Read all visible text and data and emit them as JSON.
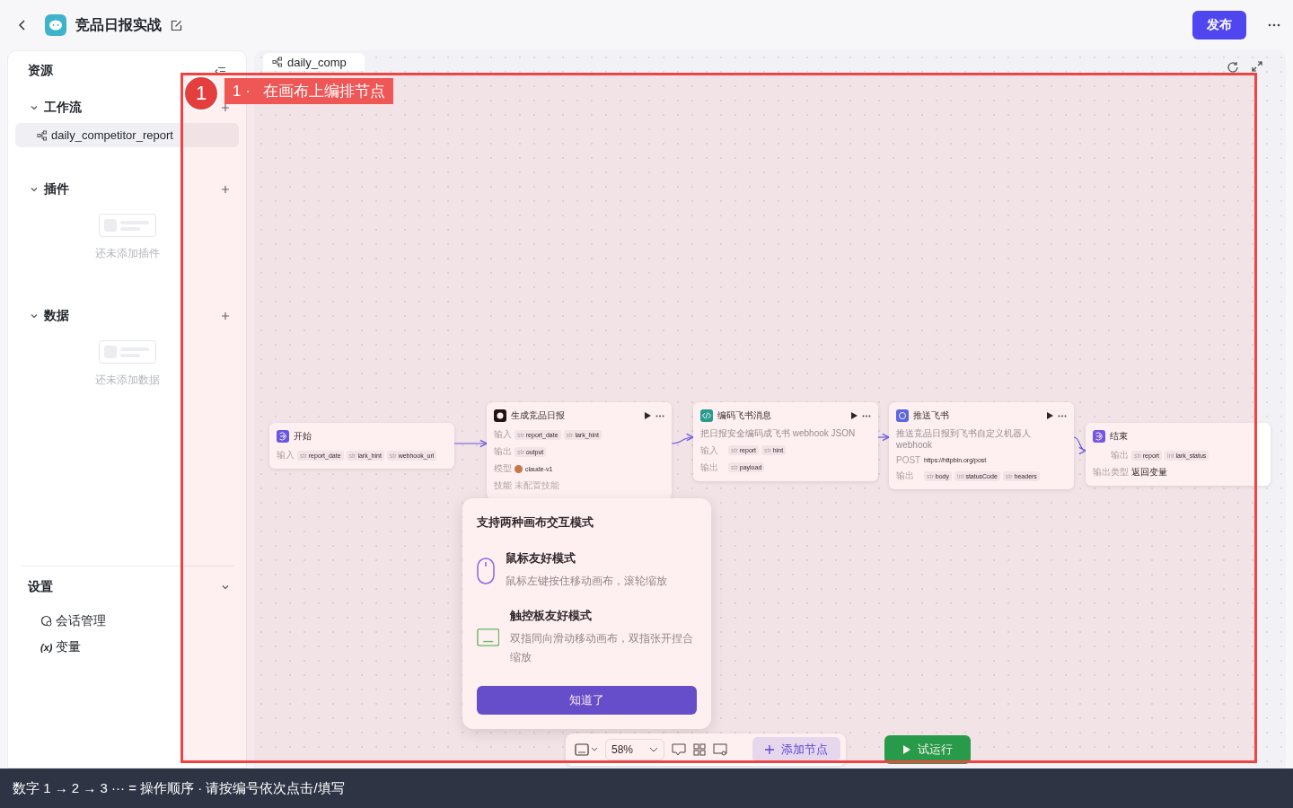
{
  "header": {
    "title": "竞品日报实战",
    "publish": "发布"
  },
  "sidebar": {
    "title": "资源",
    "sections": [
      {
        "label": "工作流",
        "expanded": true,
        "items": [
          {
            "label": "daily_competitor_report",
            "selected": true
          }
        ]
      },
      {
        "label": "插件",
        "expanded": true,
        "empty": "还未添加插件"
      },
      {
        "label": "数据",
        "expanded": true,
        "empty": "还未添加数据"
      }
    ],
    "settings": {
      "label": "设置",
      "expanded": true,
      "items": [
        {
          "kind": "session",
          "label": "会话管理"
        },
        {
          "kind": "variable",
          "glyph": "(x)",
          "label": "变量"
        }
      ]
    }
  },
  "canvas": {
    "tab": "daily_comp",
    "nodes": [
      {
        "kind": "start",
        "title": "开始",
        "rows": [
          {
            "kind": "params",
            "label": "输入",
            "params": [
              {
                "type": "str",
                "name": "report_date"
              },
              {
                "type": "str",
                "name": "lark_hint"
              },
              {
                "type": "str",
                "name": "webhook_url"
              }
            ]
          }
        ]
      },
      {
        "kind": "llm",
        "title": "生成竞品日报",
        "rows": [
          {
            "kind": "params",
            "label": "输入",
            "params": [
              {
                "type": "str",
                "name": "report_date"
              },
              {
                "type": "str",
                "name": "lark_hint"
              }
            ]
          },
          {
            "kind": "params",
            "label": "输出",
            "params": [
              {
                "type": "str",
                "name": "output"
              }
            ]
          },
          {
            "kind": "model",
            "label": "模型",
            "value": "claude-v1"
          },
          {
            "kind": "muted",
            "label": "技能",
            "value": "未配置技能"
          }
        ]
      },
      {
        "kind": "code",
        "title": "编码飞书消息",
        "description": "把日报安全编码成飞书 webhook JSON",
        "rows": [
          {
            "kind": "params",
            "label": "输入",
            "params": [
              {
                "type": "str",
                "name": "report"
              },
              {
                "type": "str",
                "name": "hint"
              }
            ]
          },
          {
            "kind": "params",
            "label": "输出",
            "params": [
              {
                "type": "str",
                "name": "payload"
              }
            ]
          }
        ]
      },
      {
        "kind": "http",
        "title": "推送飞书",
        "description": "推送竞品日报到飞书自定义机器人 webhook",
        "rows": [
          {
            "kind": "value",
            "label": "POST",
            "value": "https://httpbin.org/post"
          },
          {
            "kind": "params",
            "label": "输出",
            "params": [
              {
                "type": "str",
                "name": "body"
              },
              {
                "type": "int",
                "name": "statusCode"
              },
              {
                "type": "str",
                "name": "headers"
              }
            ]
          }
        ]
      },
      {
        "kind": "end",
        "title": "结束",
        "rows": [
          {
            "kind": "params",
            "label": "输出",
            "params": [
              {
                "type": "str",
                "name": "report"
              },
              {
                "type": "int",
                "name": "lark_status"
              }
            ]
          },
          {
            "kind": "value",
            "label": "输出类型",
            "value": "返回变量"
          }
        ]
      }
    ],
    "popup": {
      "title": "支持两种画布交互模式",
      "modes": [
        {
          "kind": "mouse",
          "title": "鼠标友好模式",
          "description": "鼠标左键按住移动画布，滚轮缩放"
        },
        {
          "kind": "trackpad",
          "title": "触控板友好模式",
          "description": "双指同向滑动移动画布，双指张开捏合缩放"
        }
      ],
      "button": "知道了"
    },
    "toolbar": {
      "zoom": "58%",
      "add": "添加节点",
      "run": "试运行"
    }
  },
  "annotation": {
    "step": "1",
    "label": "1 ·   在画布上编排节点"
  },
  "guide_bar": "数字 1 → 2 → 3 ··· = 操作顺序 ·   请按编号依次点击/填写"
}
